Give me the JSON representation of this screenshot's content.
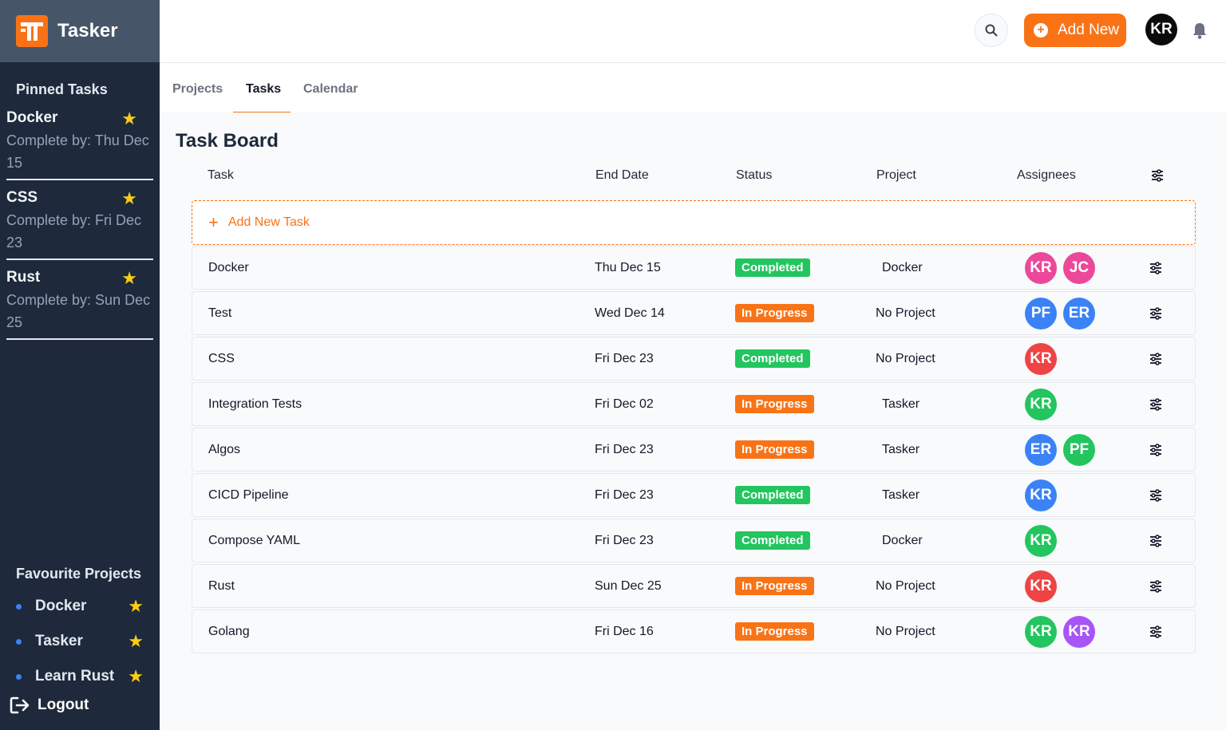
{
  "app": {
    "name": "Tasker"
  },
  "sidebar": {
    "pinned_title": "Pinned Tasks",
    "pinned": [
      {
        "name": "Docker",
        "due": "Complete by: Thu Dec 15"
      },
      {
        "name": "CSS",
        "due": "Complete by: Fri Dec 23"
      },
      {
        "name": "Rust",
        "due": "Complete by: Sun Dec 25"
      }
    ],
    "favourites_title": "Favourite Projects",
    "favourites": [
      {
        "name": "Docker"
      },
      {
        "name": "Tasker"
      },
      {
        "name": "Learn Rust"
      }
    ],
    "logout_label": "Logout"
  },
  "topbar": {
    "add_new_label": "Add New",
    "user_initials": "KR"
  },
  "tabs": [
    {
      "label": "Projects",
      "active": false
    },
    {
      "label": "Tasks",
      "active": true
    },
    {
      "label": "Calendar",
      "active": false
    }
  ],
  "board": {
    "title": "Task Board",
    "columns": {
      "task": "Task",
      "end_date": "End Date",
      "status": "Status",
      "project": "Project",
      "assignees": "Assignees"
    },
    "add_task_label": "Add New Task",
    "status_colors": {
      "Completed": "#22c55e",
      "In Progress": "#f97316"
    },
    "tasks": [
      {
        "task": "Docker",
        "end_date": "Thu Dec 15",
        "status": "Completed",
        "project": "Docker",
        "assignees": [
          {
            "initials": "KR",
            "color": "#ec4899"
          },
          {
            "initials": "JC",
            "color": "#ec4899"
          }
        ]
      },
      {
        "task": "Test",
        "end_date": "Wed Dec 14",
        "status": "In Progress",
        "project": "No Project",
        "assignees": [
          {
            "initials": "PF",
            "color": "#3b82f6"
          },
          {
            "initials": "ER",
            "color": "#3b82f6"
          }
        ]
      },
      {
        "task": "CSS",
        "end_date": "Fri Dec 23",
        "status": "Completed",
        "project": "No Project",
        "assignees": [
          {
            "initials": "KR",
            "color": "#ef4444"
          }
        ]
      },
      {
        "task": "Integration Tests",
        "end_date": "Fri Dec 02",
        "status": "In Progress",
        "project": "Tasker",
        "assignees": [
          {
            "initials": "KR",
            "color": "#22c55e"
          }
        ]
      },
      {
        "task": "Algos",
        "end_date": "Fri Dec 23",
        "status": "In Progress",
        "project": "Tasker",
        "assignees": [
          {
            "initials": "ER",
            "color": "#3b82f6"
          },
          {
            "initials": "PF",
            "color": "#22c55e"
          }
        ]
      },
      {
        "task": "CICD Pipeline",
        "end_date": "Fri Dec 23",
        "status": "Completed",
        "project": "Tasker",
        "assignees": [
          {
            "initials": "KR",
            "color": "#3b82f6"
          }
        ]
      },
      {
        "task": "Compose YAML",
        "end_date": "Fri Dec 23",
        "status": "Completed",
        "project": "Docker",
        "assignees": [
          {
            "initials": "KR",
            "color": "#22c55e"
          }
        ]
      },
      {
        "task": "Rust",
        "end_date": "Sun Dec 25",
        "status": "In Progress",
        "project": "No Project",
        "assignees": [
          {
            "initials": "KR",
            "color": "#ef4444"
          }
        ]
      },
      {
        "task": "Golang",
        "end_date": "Fri Dec 16",
        "status": "In Progress",
        "project": "No Project",
        "assignees": [
          {
            "initials": "KR",
            "color": "#22c55e"
          },
          {
            "initials": "KR",
            "color": "#a855f7"
          }
        ]
      }
    ]
  }
}
